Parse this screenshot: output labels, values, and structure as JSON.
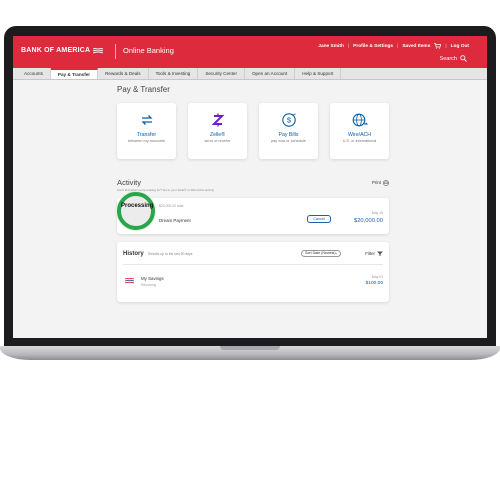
{
  "header": {
    "brand": "BANK OF AMERICA",
    "product": "Online Banking",
    "user_name": "Jane Smith",
    "profile_link": "Profile & Settings",
    "saved_items": "Saved Items",
    "logout": "Log Out",
    "search": "Search",
    "brand_color": "#dd2a3d"
  },
  "nav": {
    "tabs": [
      {
        "label": "Accounts"
      },
      {
        "label": "Pay & Transfer"
      },
      {
        "label": "Rewards & Deals"
      },
      {
        "label": "Tools & Investing"
      },
      {
        "label": "Security Center"
      },
      {
        "label": "Open an Account"
      },
      {
        "label": "Help & Support"
      }
    ],
    "active": "Pay & Transfer"
  },
  "page": {
    "title": "Pay & Transfer",
    "cards": [
      {
        "icon": "transfer-arrows-icon",
        "title": "Transfer",
        "subtitle": "between my accounts"
      },
      {
        "icon": "zelle-icon",
        "title": "Zelle®",
        "subtitle": "send or receive"
      },
      {
        "icon": "pay-bills-icon",
        "title": "Pay Bills",
        "subtitle": "pay now or schedule"
      },
      {
        "icon": "globe-icon",
        "title": "Wire/ACH",
        "subtitle": "U.S. or international"
      }
    ]
  },
  "activity": {
    "title": "Activity",
    "print": "Print",
    "note": "Can't find what you're looking for? Go to your Zelle® or Wire/ACH activity",
    "processing": {
      "label": "Processing",
      "subline": "$20,000.00 total",
      "name": "Dream Payment",
      "cancel": "Cancel",
      "date": "May 15",
      "amount": "$20,000.00"
    }
  },
  "history": {
    "title": "History",
    "subtitle": "Results up to the last 90 days",
    "sort_value": "Sort Date (Newest)",
    "filter": "Filter",
    "transactions": [
      {
        "name": "My Savings",
        "subtitle": "Recurring",
        "date": "May 03",
        "amount": "$100.00"
      }
    ]
  },
  "colors": {
    "accent_blue": "#1b5fae",
    "zelle_purple": "#6d1ed4",
    "highlight_green": "#2aa54a"
  }
}
